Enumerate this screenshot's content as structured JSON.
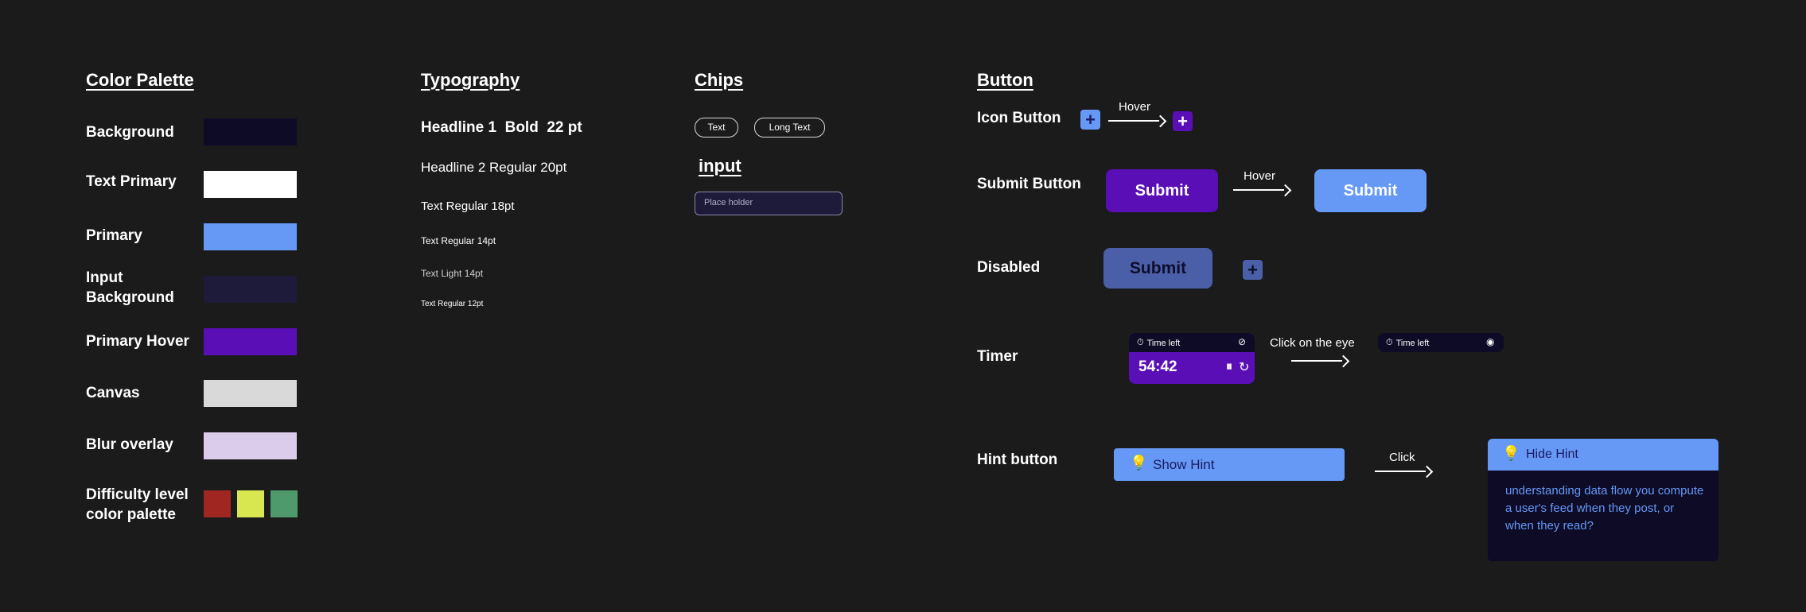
{
  "colors": {
    "background": "#1b1b1b",
    "swatch_background": "#0d0b26",
    "swatch_text_primary": "#ffffff",
    "swatch_primary": "#6698f6",
    "swatch_input_background": "#1e1a3a",
    "swatch_primary_hover": "#5a0eb6",
    "swatch_canvas": "#d9d9d9",
    "swatch_blur_overlay": "#dcccec",
    "difficulty": [
      "#a02622",
      "#d8e74f",
      "#4f9a6c"
    ],
    "disabled_button": "#4a5fa8",
    "disabled_text": "#0f0d2d"
  },
  "palette": {
    "title": "Color Palette",
    "items": [
      {
        "label": "Background"
      },
      {
        "label": "Text Primary"
      },
      {
        "label": "Primary"
      },
      {
        "label": "Input Background"
      },
      {
        "label": "Primary Hover"
      },
      {
        "label": "Canvas"
      },
      {
        "label": "Blur overlay"
      },
      {
        "label": "Difficulty level color palette"
      }
    ]
  },
  "typography": {
    "title": "Typography",
    "samples": [
      "Headline 1  Bold  22 pt",
      "Headline 2 Regular 20pt",
      "Text Regular 18pt",
      "Text Regular 14pt",
      "Text Light 14pt",
      "Text Regular 12pt"
    ]
  },
  "chips": {
    "title": "Chips",
    "items": [
      "Text",
      "Long Text"
    ],
    "input_title": "input",
    "input_placeholder": "Place holder"
  },
  "buttons": {
    "title": "Button",
    "icon_button_label": "Icon Button",
    "hover_label_1": "Hover",
    "submit_button_label": "Submit Button",
    "submit_text": "Submit",
    "hover_label_2": "Hover",
    "disabled_label": "Disabled",
    "disabled_submit_text": "Submit",
    "timer_label": "Timer",
    "time_left_label": "Time left",
    "timer_value": "54:42",
    "click_eye_label": "Click on the eye",
    "time_left_label_2": "Time left",
    "hint_button_label": "Hint button",
    "show_hint_text": "Show Hint",
    "click_label": "Click",
    "hide_hint_text": "Hide Hint",
    "hint_content": "understanding data flow you compute a user's feed when they post, or when they read?"
  },
  "icons": {
    "plus": "plus-icon",
    "clock": "clock-icon",
    "eye_off": "eye-off-icon",
    "eye": "eye-icon",
    "pause": "pause-icon",
    "restart": "restart-icon",
    "bulb": "lightbulb-icon",
    "arrow": "arrow-right-icon"
  }
}
